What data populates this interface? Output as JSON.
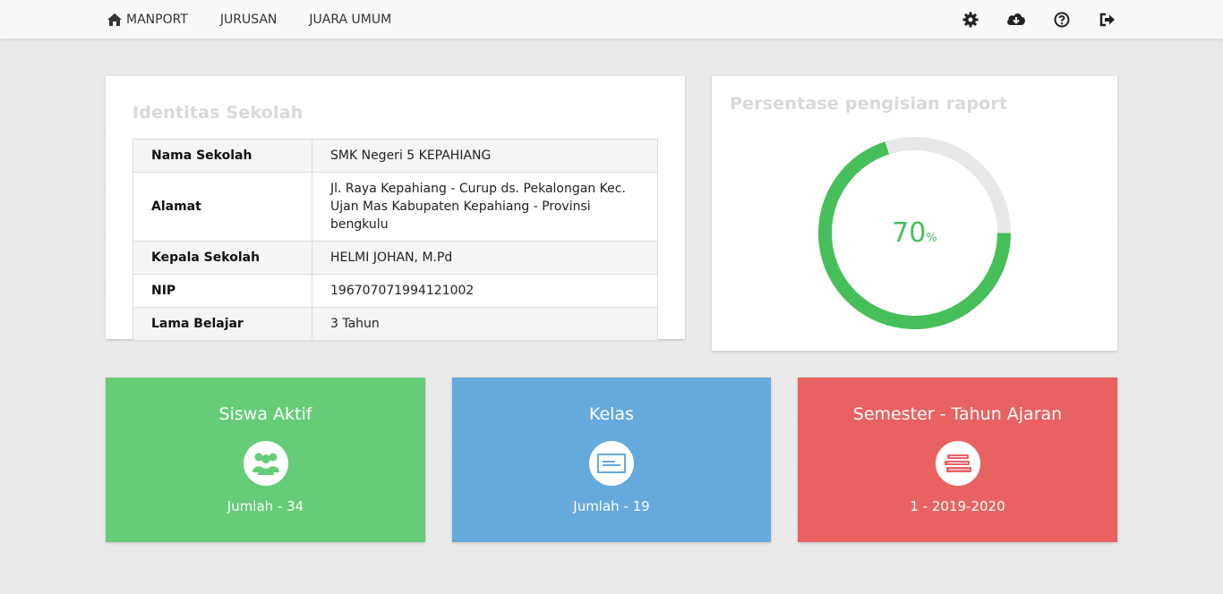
{
  "nav": {
    "brand": "MANPORT",
    "links": [
      "JURUSAN",
      "JUARA UMUM"
    ],
    "icons": [
      "gear-icon",
      "cloud-download-icon",
      "help-icon",
      "logout-icon"
    ]
  },
  "identity": {
    "title": "Identitas Sekolah",
    "rows": [
      {
        "key": "Nama Sekolah",
        "value": "SMK Negeri 5 KEPAHIANG"
      },
      {
        "key": "Alamat",
        "value": "Jl. Raya Kepahiang - Curup ds. Pekalongan Kec. Ujan Mas Kabupaten Kepahiang - Provinsi bengkulu"
      },
      {
        "key": "Kepala Sekolah",
        "value": "HELMI JOHAN, M.Pd"
      },
      {
        "key": "NIP",
        "value": "196707071994121002"
      },
      {
        "key": "Lama Belajar",
        "value": "3 Tahun"
      }
    ]
  },
  "progress": {
    "title": "Persentase pengisian raport",
    "value": "70",
    "unit": "%",
    "fraction": 0.7,
    "fill_color": "#46bf5a",
    "track_color": "#e8e8e8"
  },
  "tiles": [
    {
      "title": "Siswa Aktif",
      "count": "Jumlah - 34",
      "color": "#66cc78",
      "icon": "users-icon"
    },
    {
      "title": "Kelas",
      "count": "Jumlah - 19",
      "color": "#66a9dd",
      "icon": "board-icon"
    },
    {
      "title": "Semester - Tahun Ajaran",
      "count": "1 - 2019-2020",
      "color": "#e96262",
      "icon": "books-icon"
    }
  ]
}
